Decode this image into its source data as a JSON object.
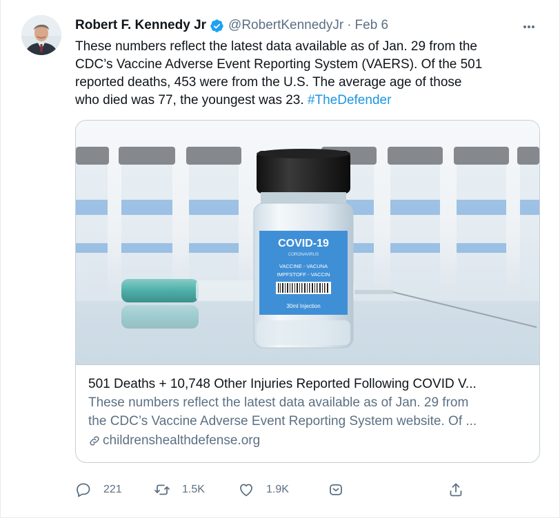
{
  "tweet": {
    "author": {
      "name": "Robert F. Kennedy Jr",
      "handle": "@RobertKennedyJr",
      "separator": "·",
      "date": "Feb 6"
    },
    "text_lines": [
      "These numbers reflect the latest data available as of Jan. 29 from the",
      "CDC’s Vaccine Adverse Event Reporting System (VAERS). Of the 501",
      "reported deaths, 453 were from the U.S. The average age of those",
      "who died was 77, the youngest was 23. "
    ],
    "hashtag": "#TheDefender"
  },
  "card": {
    "image": {
      "label_title": "COVID-19",
      "label_sub": "CORONAVIRUS",
      "label_line1": "VACCINE - VACUNA",
      "label_line2": "IMPFSTOFF - VACCIN",
      "label_volume": "30ml Injection"
    },
    "title": "501 Deaths + 10,748 Other Injuries Reported Following COVID V...",
    "desc_lines": [
      "These numbers reflect the latest data available as of Jan. 29 from",
      "the CDC’s Vaccine Adverse Event Reporting System website. Of ..."
    ],
    "domain": "childrenshealthdefense.org"
  },
  "actions": {
    "reply_count": "221",
    "retweet_count": "1.5K",
    "like_count": "1.9K"
  },
  "colors": {
    "link": "#1b95e0",
    "secondary_text": "#5b7083",
    "verified": "#1da1f2",
    "border": "#c4cfd6"
  },
  "icons": [
    "verified-badge-icon",
    "more-icon",
    "link-icon",
    "reply-icon",
    "retweet-icon",
    "like-icon",
    "share-dm-icon",
    "share-icon"
  ]
}
